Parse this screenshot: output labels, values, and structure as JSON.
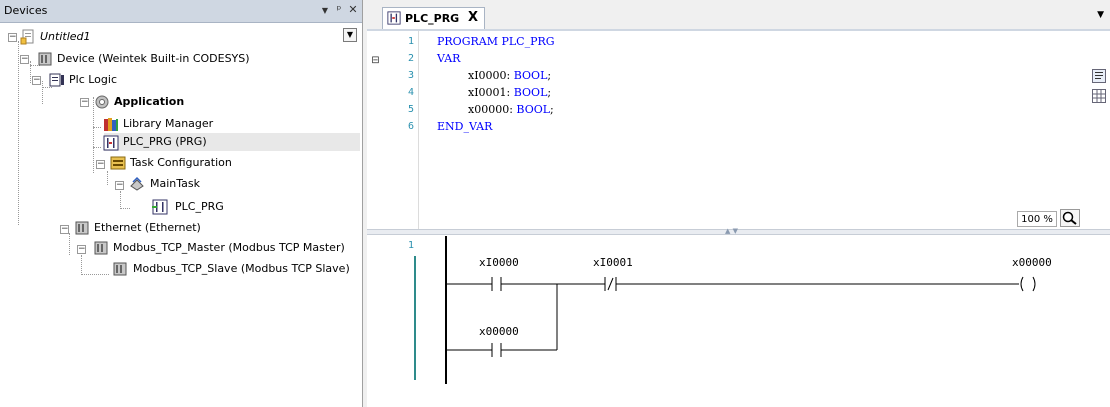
{
  "devices_panel": {
    "title": "Devices",
    "header_icons": [
      "dropdown-arrow-icon",
      "pin-icon",
      "close-icon"
    ],
    "tree": [
      {
        "label": "Untitled1",
        "italic": true,
        "icon": "project-icon"
      },
      {
        "label": "Device (Weintek Built-in CODESYS)",
        "icon": "device-icon"
      },
      {
        "label": "Plc Logic",
        "icon": "plc-logic-icon"
      },
      {
        "label": "Application",
        "bold": true,
        "icon": "application-gear-icon"
      },
      {
        "label": "Library Manager",
        "icon": "library-manager-icon"
      },
      {
        "label": "PLC_PRG (PRG)",
        "icon": "pou-icon",
        "selected": true
      },
      {
        "label": "Task Configuration",
        "icon": "task-configuration-icon"
      },
      {
        "label": "MainTask",
        "icon": "task-icon"
      },
      {
        "label": "PLC_PRG",
        "icon": "pou-call-icon"
      },
      {
        "label": "Ethernet (Ethernet)",
        "icon": "device-icon"
      },
      {
        "label": "Modbus_TCP_Master (Modbus TCP Master)",
        "icon": "device-icon"
      },
      {
        "label": "Modbus_TCP_Slave (Modbus TCP Slave)",
        "icon": "device-icon"
      }
    ]
  },
  "editor": {
    "tab_label": "PLC_PRG",
    "tab_close": "X",
    "code": {
      "line_numbers": [
        "1",
        "2",
        "3",
        "4",
        "5",
        "6"
      ],
      "lines": [
        {
          "text": "PROGRAM PLC_PRG"
        },
        {
          "text": "VAR"
        },
        {
          "name": "xI0000",
          "type": "BOOL"
        },
        {
          "name": "xI0001",
          "type": "BOOL"
        },
        {
          "name": "x00000",
          "type": "BOOL"
        },
        {
          "text": "END_VAR"
        }
      ]
    },
    "zoom": "100 %",
    "ladder": {
      "network_number": "1",
      "contact1_label": "xI0000",
      "contact2_label": "xI0001",
      "contact3_label": "x00000",
      "coil_label": "x00000"
    }
  },
  "colors": {
    "keyword": "#0000ff",
    "line_number": "#2b91af",
    "panel_header": "#cfd7e2",
    "network_bar": "#2e8b8b"
  }
}
